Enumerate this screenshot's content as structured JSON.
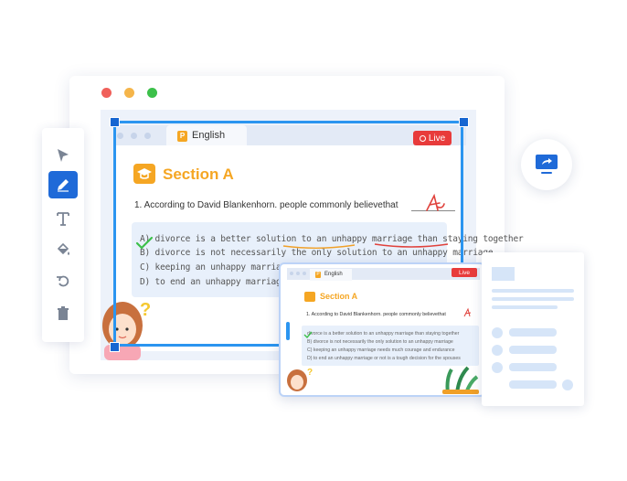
{
  "tab_label": "English",
  "live_label": "Live",
  "section_title": "Section A",
  "question": "1. According to David Blankenhorn. people commonly believethat",
  "answers": [
    "A) divorce is a better solution to an unhappy marriage than staying together",
    "B) divorce is not necessarily the only solution to an unhappy marriage",
    "C) keeping an unhappy marriage r",
    "D) to end an unhappy marriage or"
  ],
  "tablet": {
    "tab_label": "English",
    "live_label": "Live",
    "section_title": "Section A",
    "question": "1. According to David Blankenhorn. people commonly believethat",
    "answers": [
      "divorce is a better solution to an unhappy marriage than staying together",
      "B) divorce is not necessarily the only solution to an unhappy marriage",
      "C) keeping an unhappy marriage needs much courage and endurance",
      "D) to end an unhappy marriage or not is a tough decision for the spouses"
    ]
  },
  "colors": {
    "accent": "#1f6ad8",
    "frame": "#2b95f0",
    "section": "#f5a623",
    "live": "#e83b3b"
  },
  "icons": [
    "cursor-icon",
    "pen-icon",
    "text-icon",
    "paint-bucket-icon",
    "undo-icon",
    "trash-icon",
    "screen-share-icon"
  ]
}
